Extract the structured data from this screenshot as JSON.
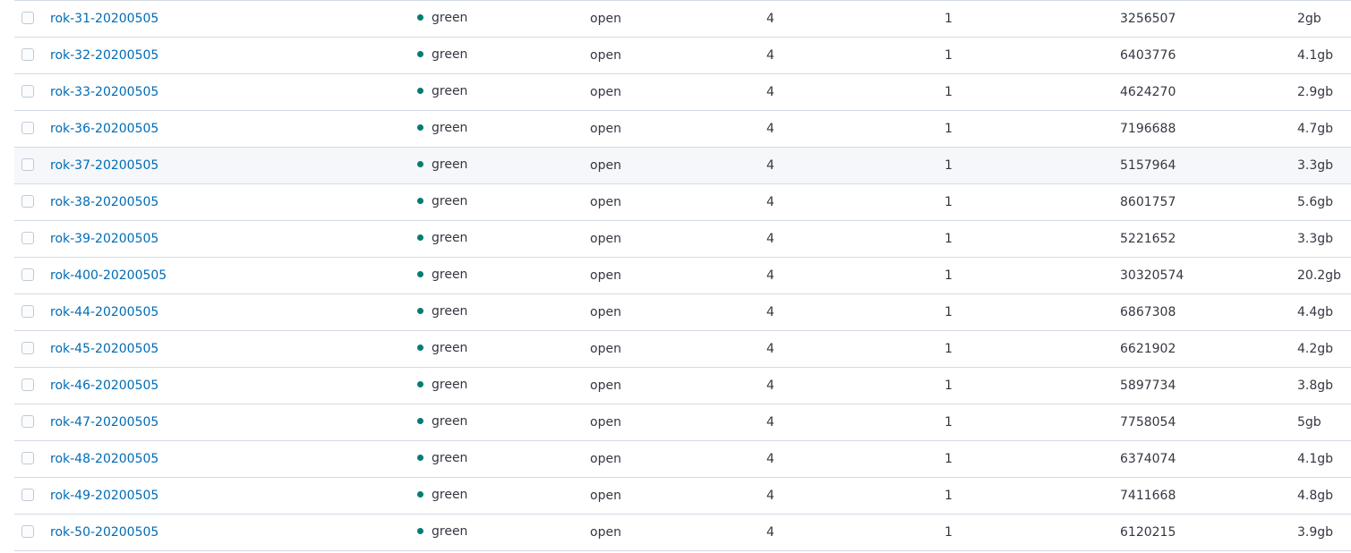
{
  "colors": {
    "health_green": "#017d73",
    "link": "#006bb4",
    "border": "#d3dae6"
  },
  "rows": [
    {
      "name": "rok-31-20200505",
      "health": "green",
      "status": "open",
      "primaries": "4",
      "replicas": "1",
      "docs_count": "3256507",
      "storage_size": "2gb"
    },
    {
      "name": "rok-32-20200505",
      "health": "green",
      "status": "open",
      "primaries": "4",
      "replicas": "1",
      "docs_count": "6403776",
      "storage_size": "4.1gb"
    },
    {
      "name": "rok-33-20200505",
      "health": "green",
      "status": "open",
      "primaries": "4",
      "replicas": "1",
      "docs_count": "4624270",
      "storage_size": "2.9gb"
    },
    {
      "name": "rok-36-20200505",
      "health": "green",
      "status": "open",
      "primaries": "4",
      "replicas": "1",
      "docs_count": "7196688",
      "storage_size": "4.7gb"
    },
    {
      "name": "rok-37-20200505",
      "health": "green",
      "status": "open",
      "primaries": "4",
      "replicas": "1",
      "docs_count": "5157964",
      "storage_size": "3.3gb"
    },
    {
      "name": "rok-38-20200505",
      "health": "green",
      "status": "open",
      "primaries": "4",
      "replicas": "1",
      "docs_count": "8601757",
      "storage_size": "5.6gb"
    },
    {
      "name": "rok-39-20200505",
      "health": "green",
      "status": "open",
      "primaries": "4",
      "replicas": "1",
      "docs_count": "5221652",
      "storage_size": "3.3gb"
    },
    {
      "name": "rok-400-20200505",
      "health": "green",
      "status": "open",
      "primaries": "4",
      "replicas": "1",
      "docs_count": "30320574",
      "storage_size": "20.2gb"
    },
    {
      "name": "rok-44-20200505",
      "health": "green",
      "status": "open",
      "primaries": "4",
      "replicas": "1",
      "docs_count": "6867308",
      "storage_size": "4.4gb"
    },
    {
      "name": "rok-45-20200505",
      "health": "green",
      "status": "open",
      "primaries": "4",
      "replicas": "1",
      "docs_count": "6621902",
      "storage_size": "4.2gb"
    },
    {
      "name": "rok-46-20200505",
      "health": "green",
      "status": "open",
      "primaries": "4",
      "replicas": "1",
      "docs_count": "5897734",
      "storage_size": "3.8gb"
    },
    {
      "name": "rok-47-20200505",
      "health": "green",
      "status": "open",
      "primaries": "4",
      "replicas": "1",
      "docs_count": "7758054",
      "storage_size": "5gb"
    },
    {
      "name": "rok-48-20200505",
      "health": "green",
      "status": "open",
      "primaries": "4",
      "replicas": "1",
      "docs_count": "6374074",
      "storage_size": "4.1gb"
    },
    {
      "name": "rok-49-20200505",
      "health": "green",
      "status": "open",
      "primaries": "4",
      "replicas": "1",
      "docs_count": "7411668",
      "storage_size": "4.8gb"
    },
    {
      "name": "rok-50-20200505",
      "health": "green",
      "status": "open",
      "primaries": "4",
      "replicas": "1",
      "docs_count": "6120215",
      "storage_size": "3.9gb"
    }
  ]
}
